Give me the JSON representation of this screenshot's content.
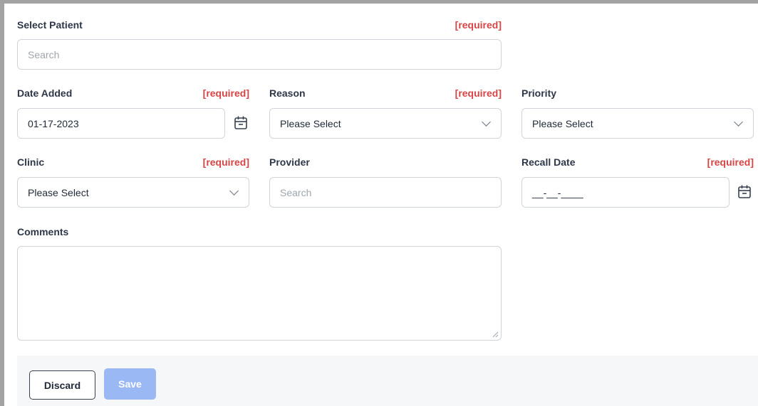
{
  "form": {
    "select_patient": {
      "label": "Select Patient",
      "required": "[required]",
      "placeholder": "Search"
    },
    "date_added": {
      "label": "Date Added",
      "required": "[required]",
      "value": "01-17-2023",
      "icon": "calendar-icon"
    },
    "reason": {
      "label": "Reason",
      "required": "[required]",
      "value": "Please Select"
    },
    "priority": {
      "label": "Priority",
      "value": "Please Select"
    },
    "clinic": {
      "label": "Clinic",
      "required": "[required]",
      "value": "Please Select"
    },
    "provider": {
      "label": "Provider",
      "placeholder": "Search"
    },
    "recall_date": {
      "label": "Recall Date",
      "required": "[required]",
      "value": "__-__-____",
      "icon": "calendar-icon"
    },
    "comments": {
      "label": "Comments",
      "value": ""
    }
  },
  "footer": {
    "discard_label": "Discard",
    "save_label": "Save"
  },
  "colors": {
    "required": "#d64545",
    "save_button": "#9ab8f3",
    "border": "#d1d5db",
    "frame": "#a3a3a3"
  }
}
